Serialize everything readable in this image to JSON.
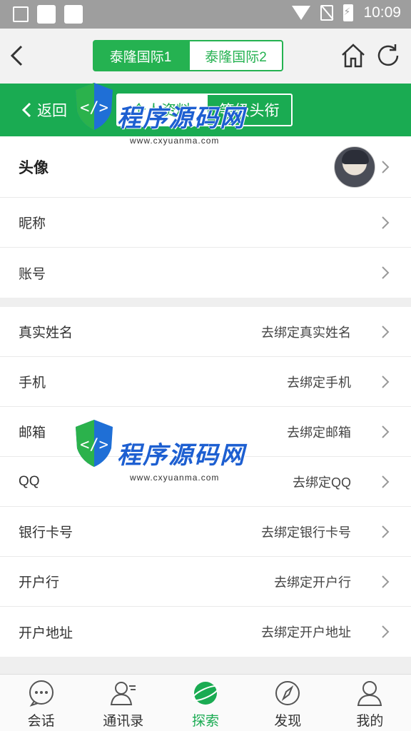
{
  "status_bar": {
    "time": "10:09"
  },
  "header": {
    "tabs": [
      {
        "label": "泰隆国际1",
        "active": true
      },
      {
        "label": "泰隆国际2",
        "active": false
      }
    ]
  },
  "sub_header": {
    "back_label": "返回",
    "tabs": [
      {
        "label": "个人资料",
        "active": true
      },
      {
        "label": "等级头衔",
        "active": false
      }
    ]
  },
  "profile": {
    "avatar_label": "头像",
    "nickname_label": "昵称",
    "account_label": "账号"
  },
  "bindings": [
    {
      "label": "真实姓名",
      "action": "去绑定真实姓名"
    },
    {
      "label": "手机",
      "action": "去绑定手机"
    },
    {
      "label": "邮箱",
      "action": "去绑定邮箱"
    },
    {
      "label": "QQ",
      "action": "去绑定QQ"
    },
    {
      "label": "银行卡号",
      "action": "去绑定银行卡号"
    },
    {
      "label": "开户行",
      "action": "去绑定开户行"
    },
    {
      "label": "开户地址",
      "action": "去绑定开户地址"
    }
  ],
  "watermark": {
    "title": "程序源码网",
    "url": "www.cxyuanma.com"
  },
  "tabbar": [
    {
      "label": "会话",
      "icon": "chat-icon",
      "active": false
    },
    {
      "label": "通讯录",
      "icon": "contacts-icon",
      "active": false
    },
    {
      "label": "探索",
      "icon": "planet-icon",
      "active": true
    },
    {
      "label": "发现",
      "icon": "compass-icon",
      "active": false
    },
    {
      "label": "我的",
      "icon": "user-icon",
      "active": false
    }
  ],
  "colors": {
    "accent": "#1aab52",
    "header_tab": "#25b251",
    "status_bar": "#9e9e9e"
  }
}
